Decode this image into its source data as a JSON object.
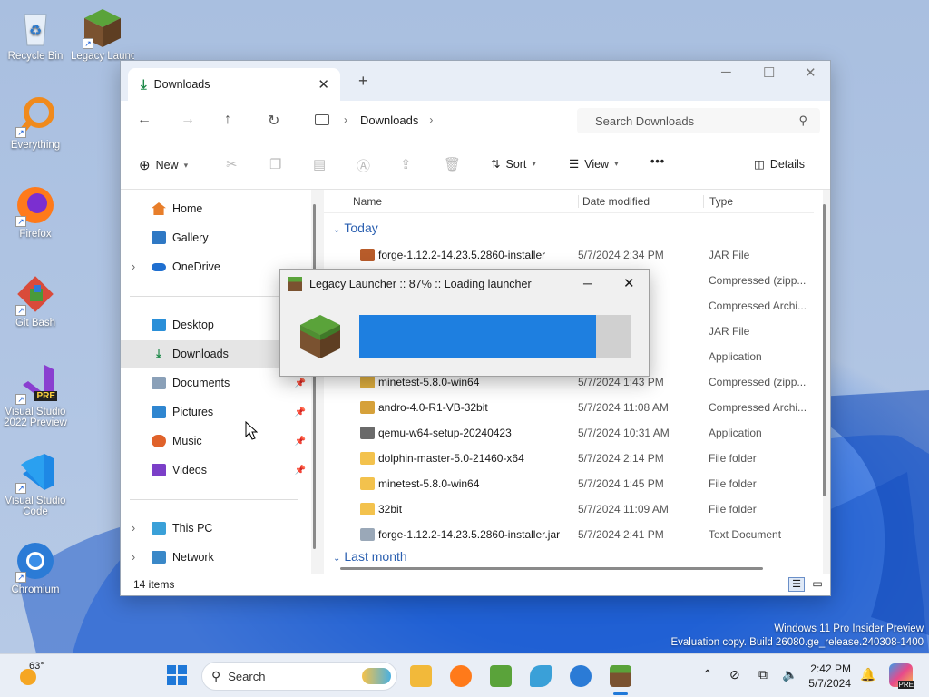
{
  "desktop": {
    "icons": [
      {
        "label": "Recycle Bin"
      },
      {
        "label": "Legacy Launch"
      },
      {
        "label": "Everything"
      },
      {
        "label": "Firefox"
      },
      {
        "label": "Git Bash"
      },
      {
        "label": "Visual Studio 2022 Preview"
      },
      {
        "label": "Visual Studio Code"
      },
      {
        "label": "Chromium"
      }
    ],
    "watermark1": "Windows 11 Pro Insider Preview",
    "watermark2": "Evaluation copy. Build 26080.ge_release.240308-1400",
    "pre_badge": "PRE"
  },
  "explorer": {
    "tab_title": "Downloads",
    "tab_close": "✕",
    "new_tab": "+",
    "minimize": "─",
    "maximize": "☐",
    "close": "✕",
    "nav_back": "←",
    "nav_forward": "→",
    "nav_up": "↑",
    "nav_refresh": "↻",
    "breadcrumb": "Downloads",
    "search_placeholder": "Search Downloads",
    "cmd": {
      "new": "New",
      "sort": "Sort",
      "view": "View",
      "more": "•••",
      "details": "Details"
    },
    "nav_items": [
      "Home",
      "Gallery",
      "OneDrive",
      "Desktop",
      "Downloads",
      "Documents",
      "Pictures",
      "Music",
      "Videos",
      "This PC",
      "Network"
    ],
    "columns": {
      "name": "Name",
      "date": "Date modified",
      "type": "Type"
    },
    "group_today": "Today",
    "group_last": "Last month",
    "files": [
      {
        "name": "forge-1.12.2-14.23.5.2860-installer",
        "date": "5/7/2024 2:34 PM",
        "type": "JAR File"
      },
      {
        "name": "",
        "date": "",
        "type": "Compressed (zipp..."
      },
      {
        "name": "",
        "date": "",
        "type": "Compressed Archi..."
      },
      {
        "name": "",
        "date": "",
        "type": "JAR File"
      },
      {
        "name": "",
        "date": "",
        "type": "Application"
      },
      {
        "name": "minetest-5.8.0-win64",
        "date": "5/7/2024 1:43 PM",
        "type": "Compressed (zipp..."
      },
      {
        "name": "andro-4.0-R1-VB-32bit",
        "date": "5/7/2024 11:08 AM",
        "type": "Compressed Archi..."
      },
      {
        "name": "qemu-w64-setup-20240423",
        "date": "5/7/2024 10:31 AM",
        "type": "Application"
      },
      {
        "name": "dolphin-master-5.0-21460-x64",
        "date": "5/7/2024 2:14 PM",
        "type": "File folder"
      },
      {
        "name": "minetest-5.8.0-win64",
        "date": "5/7/2024 1:45 PM",
        "type": "File folder"
      },
      {
        "name": "32bit",
        "date": "5/7/2024 11:09 AM",
        "type": "File folder"
      },
      {
        "name": "forge-1.12.2-14.23.5.2860-installer.jar",
        "date": "5/7/2024 2:41 PM",
        "type": "Text Document"
      }
    ],
    "status": "14 items"
  },
  "dialog": {
    "title": "Legacy Launcher :: 87% :: Loading launcher",
    "minimize": "─",
    "close": "✕",
    "progress": 0.87
  },
  "taskbar": {
    "weather": "63°",
    "search": "Search",
    "time": "2:42 PM",
    "date": "5/7/2024",
    "copilot_badge": "PRE"
  },
  "colors": {
    "accent": "#1e88e5",
    "taskbar": "#e9eef6"
  }
}
